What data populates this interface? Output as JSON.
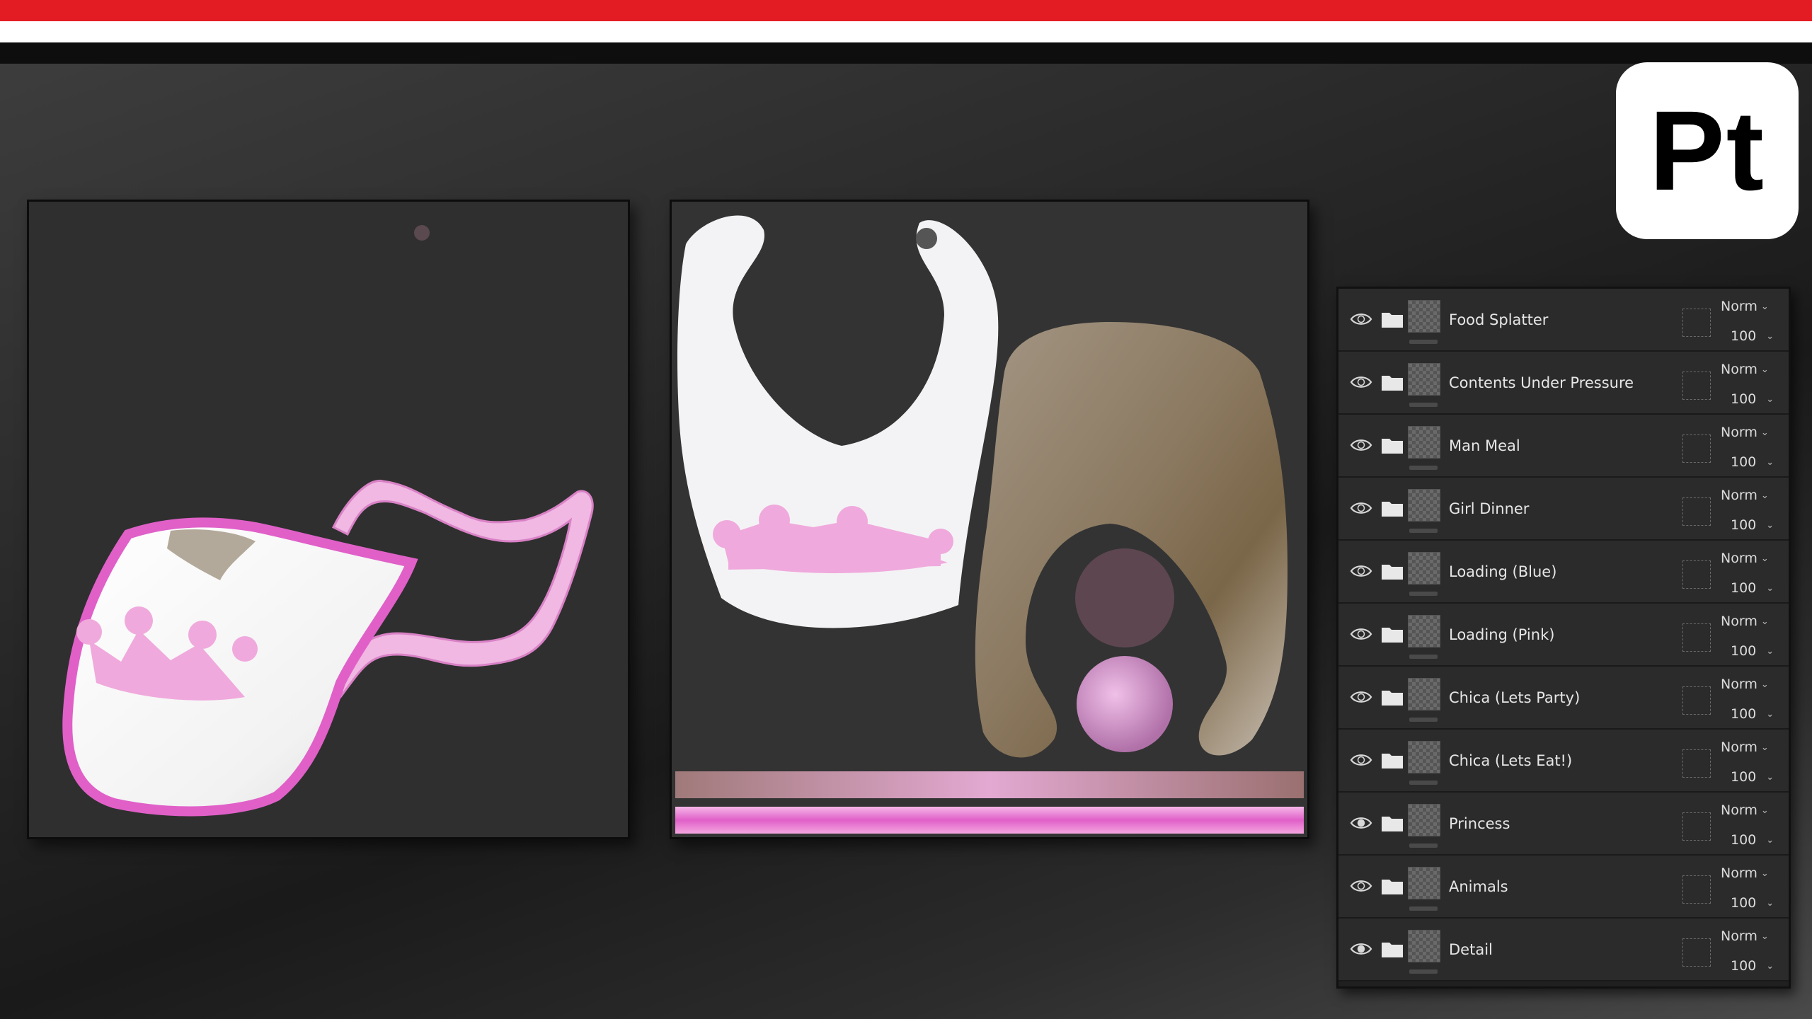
{
  "app": {
    "logo_text": "Pt"
  },
  "colors": {
    "red_bar": "#e31b23",
    "white_bar": "#ffffff",
    "black_bar": "#0e0e0e",
    "bib_pink": "#f0a9dc",
    "bib_trim": "#e060c8"
  },
  "layers": [
    {
      "name": "Food Splatter",
      "visible": false,
      "blend": "Norm",
      "opacity": "100"
    },
    {
      "name": "Contents Under Pressure",
      "visible": false,
      "blend": "Norm",
      "opacity": "100"
    },
    {
      "name": "Man Meal",
      "visible": false,
      "blend": "Norm",
      "opacity": "100"
    },
    {
      "name": "Girl Dinner",
      "visible": false,
      "blend": "Norm",
      "opacity": "100"
    },
    {
      "name": "Loading (Blue)",
      "visible": false,
      "blend": "Norm",
      "opacity": "100"
    },
    {
      "name": "Loading (Pink)",
      "visible": false,
      "blend": "Norm",
      "opacity": "100"
    },
    {
      "name": "Chica (Lets Party)",
      "visible": false,
      "blend": "Norm",
      "opacity": "100"
    },
    {
      "name": "Chica (Lets Eat!)",
      "visible": false,
      "blend": "Norm",
      "opacity": "100"
    },
    {
      "name": "Princess",
      "visible": true,
      "blend": "Norm",
      "opacity": "100"
    },
    {
      "name": "Animals",
      "visible": false,
      "blend": "Norm",
      "opacity": "100"
    },
    {
      "name": "Detail",
      "visible": true,
      "blend": "Norm",
      "opacity": "100"
    }
  ],
  "icons": {
    "visibility": "eye-icon",
    "group": "folder-icon",
    "dropdown": "chevron-down-icon"
  }
}
